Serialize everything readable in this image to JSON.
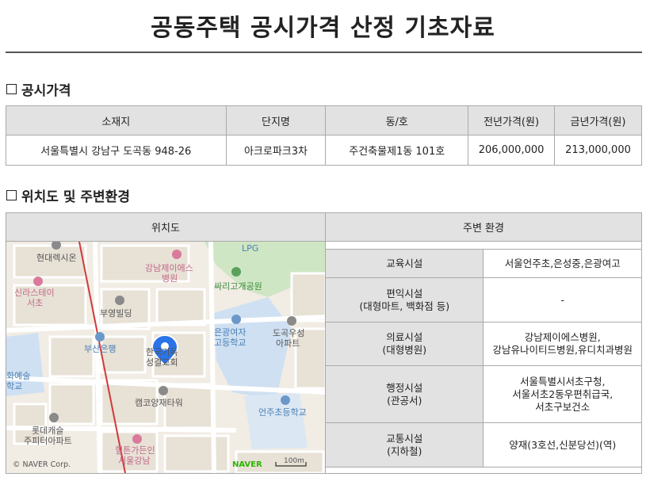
{
  "title": "공동주택 공시가격 산정 기초자료",
  "section1": {
    "title": "공시가격",
    "headers": [
      "소재지",
      "단지명",
      "동/호",
      "전년가격(원)",
      "금년가격(원)"
    ],
    "row": [
      "서울특별시 강남구 도곡동 948-26",
      "아크로파크3차",
      "주건축물제1동 101호",
      "206,000,000",
      "213,000,000"
    ]
  },
  "section2": {
    "title": "위치도 및 주변환경",
    "map_header": "위치도",
    "env_header": "주변 환경",
    "rows": [
      {
        "cat": [
          "교육시설"
        ],
        "val": [
          "서울언주초,은성중,은광여고"
        ]
      },
      {
        "cat": [
          "편익시설",
          "(대형마트, 백화점 등)"
        ],
        "val": [
          "-"
        ]
      },
      {
        "cat": [
          "의료시설",
          "(대형병원)"
        ],
        "val": [
          "강남제이에스병원,",
          "강남유나이티드병원,유디치과병원"
        ]
      },
      {
        "cat": [
          "행정시설",
          "(관공서)"
        ],
        "val": [
          "서울특별시서초구청,",
          "서울서초2동우편취급국,",
          "서초구보건소"
        ]
      },
      {
        "cat": [
          "교통시설",
          "(지하철)"
        ],
        "val": [
          "양재(3호선,신분당선)(역)"
        ]
      }
    ]
  },
  "map": {
    "labels": {
      "hyundai": "현대렉시온",
      "lpg": "LPG",
      "gn_js_1": "강남제이에스",
      "gn_js_2": "병원",
      "ssari": "싸리고개공원",
      "shilla_1": "신라스테이",
      "shilla_2": "서초",
      "buyoung": "부영빌딩",
      "eunkwang_1": "은광여자",
      "eunkwang_2": "고등학교",
      "dogok_1": "도곡우성",
      "dogok_2": "아파트",
      "busan": "부산은행",
      "church_1": "한국기독",
      "church_2": "성결교회",
      "art_1": "화예술",
      "art_2": "학교",
      "campco": "캠코양재타워",
      "eonju": "언주초등학교",
      "lotte_1": "롯데캐슬",
      "lotte_2": "주피터아파트",
      "hilton_1": "힐튼가든인",
      "hilton_2": "서울강남",
      "copyright": "© NAVER Corp.",
      "naver": "NAVER",
      "scale": "100m"
    }
  }
}
